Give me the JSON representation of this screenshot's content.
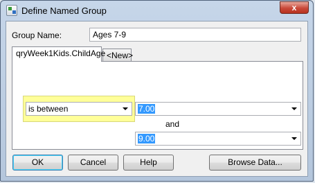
{
  "window": {
    "title": "Define Named Group",
    "close_glyph": "x"
  },
  "form": {
    "group_name_label": "Group Name:",
    "group_name_value": "Ages 7-9"
  },
  "tabs": [
    {
      "label": "qryWeek1Kids.ChildAge",
      "active": true
    },
    {
      "label": "<New>",
      "active": false
    }
  ],
  "criteria": {
    "operator": "is between",
    "value_from": "7.00",
    "conjunction": "and",
    "value_to": "9.00"
  },
  "buttons": {
    "ok": "OK",
    "cancel": "Cancel",
    "help": "Help",
    "browse": "Browse Data..."
  },
  "colors": {
    "highlight_yellow": "#ffff99",
    "selection_blue": "#3399ff",
    "close_red": "#c9493a"
  },
  "icons": [
    "app-icon",
    "dropdown-arrow-icon",
    "close-icon"
  ]
}
